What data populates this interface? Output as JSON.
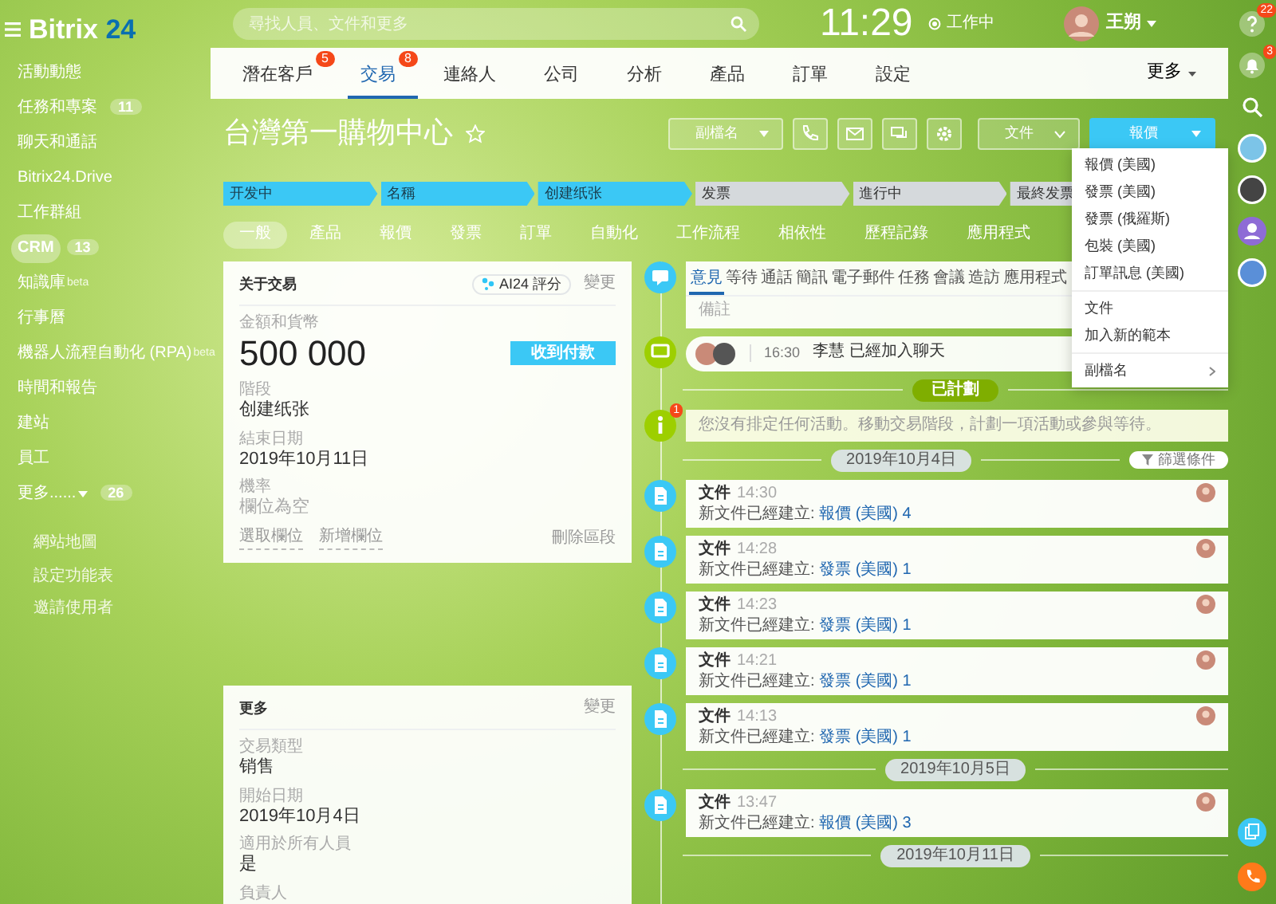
{
  "sidebar": {
    "logo": {
      "text": "Bitrix",
      "number": "24"
    },
    "items": [
      {
        "label": "活動動態",
        "selected": false
      },
      {
        "label": "任務和專案",
        "counter": "11",
        "selected": false
      },
      {
        "label": "聊天和通話",
        "selected": false
      },
      {
        "label": "Bitrix24.Drive",
        "selected": false
      },
      {
        "label": "工作群組",
        "selected": false
      },
      {
        "label": "CRM",
        "counter": "13",
        "selected": true
      },
      {
        "label": "知識庫",
        "beta": "beta",
        "selected": false
      },
      {
        "label": "行事曆",
        "selected": false
      },
      {
        "label": "機器人流程自動化 (RPA)",
        "beta": "beta",
        "selected": false
      },
      {
        "label": "時間和報告",
        "selected": false
      },
      {
        "label": "建站",
        "selected": false
      },
      {
        "label": "員工",
        "selected": false
      },
      {
        "label": "更多......",
        "counter": "26",
        "caret": true,
        "selected": false
      }
    ],
    "footer_links": [
      "網站地圖",
      "設定功能表",
      "邀請使用者"
    ]
  },
  "topbar": {
    "search": {
      "placeholder": "尋找人員、文件和更多"
    },
    "clock": "11:29",
    "work_status": "工作中",
    "user": "王朔"
  },
  "right_bar": {
    "help_counter": "22",
    "notify_counter": "3"
  },
  "crm_tabs": [
    {
      "label": "潛在客戶",
      "counter": "5",
      "selected": false
    },
    {
      "label": "交易",
      "counter": "8",
      "selected": true
    },
    {
      "label": "連絡人",
      "selected": false
    },
    {
      "label": "公司",
      "selected": false
    },
    {
      "label": "分析",
      "selected": false
    },
    {
      "label": "產品",
      "selected": false
    },
    {
      "label": "訂單",
      "selected": false
    },
    {
      "label": "設定",
      "selected": false
    }
  ],
  "crm_more": "更多",
  "deal": {
    "title": "台灣第一購物中心",
    "buttons": {
      "extension": "副檔名",
      "documents": "文件",
      "quote": "報價"
    },
    "stages": [
      {
        "label": "开发中",
        "done": true
      },
      {
        "label": "名稱",
        "done": true
      },
      {
        "label": "创建纸张",
        "done": true
      },
      {
        "label": "发票",
        "done": false
      },
      {
        "label": "進行中",
        "done": false
      },
      {
        "label": "最終发票",
        "done": false
      }
    ],
    "tabs": [
      {
        "label": "一般",
        "selected": true
      },
      {
        "label": "產品",
        "selected": false
      },
      {
        "label": "報價",
        "selected": false
      },
      {
        "label": "發票",
        "selected": false
      },
      {
        "label": "訂單",
        "selected": false
      },
      {
        "label": "自動化",
        "selected": false
      },
      {
        "label": "工作流程",
        "selected": false
      },
      {
        "label": "相依性",
        "selected": false
      },
      {
        "label": "歷程記錄",
        "selected": false
      },
      {
        "label": "應用程式",
        "selected": false
      }
    ]
  },
  "about_card": {
    "title": "关于交易",
    "ai_score": "AI24 評分",
    "change": "變更",
    "amount_label": "金額和貨幣",
    "amount": "500 000",
    "receive_payment": "收到付款",
    "fields": [
      {
        "label": "階段",
        "value": "创建纸张",
        "empty": false
      },
      {
        "label": "結束日期",
        "value": "2019年10月11日",
        "empty": false
      },
      {
        "label": "機率",
        "value": "欄位為空",
        "empty": true
      }
    ],
    "links": [
      "選取欄位",
      "新增欄位"
    ],
    "delete_section": "刪除區段"
  },
  "more_card": {
    "title": "更多",
    "change": "變更",
    "fields": [
      {
        "label": "交易類型",
        "value": "销售"
      },
      {
        "label": "開始日期",
        "value": "2019年10月4日"
      },
      {
        "label": "適用於所有人員",
        "value": "是"
      },
      {
        "label": "負責人"
      }
    ]
  },
  "timeline": {
    "tabs": [
      {
        "label": "意見",
        "selected": true
      },
      {
        "label": "等待",
        "selected": false
      },
      {
        "label": "通話",
        "selected": false
      },
      {
        "label": "簡訊",
        "selected": false
      },
      {
        "label": "電子郵件",
        "selected": false
      },
      {
        "label": "任務",
        "selected": false
      },
      {
        "label": "會議",
        "selected": false
      },
      {
        "label": "造訪",
        "selected": false
      },
      {
        "label": "應用程式",
        "selected": false
      }
    ],
    "comment_placeholder": "備註",
    "chat": {
      "time": "16:30",
      "text": "李慧 已經加入聊天"
    },
    "planned_label": "已計劃",
    "notice": {
      "counter": "1",
      "text": "您沒有排定任何活動。移動交易階段，計劃一項活動或參與等待。"
    },
    "filter": "篩選條件",
    "groups": [
      {
        "date": "2019年10月4日",
        "entries": [
          {
            "title": "文件",
            "time": "14:30",
            "text": "新文件已經建立:",
            "link": "報價 (美國) 4"
          },
          {
            "title": "文件",
            "time": "14:28",
            "text": "新文件已經建立:",
            "link": "發票 (美國) 1"
          },
          {
            "title": "文件",
            "time": "14:23",
            "text": "新文件已經建立:",
            "link": "發票 (美國) 1"
          },
          {
            "title": "文件",
            "time": "14:21",
            "text": "新文件已經建立:",
            "link": "發票 (美國) 1"
          },
          {
            "title": "文件",
            "time": "14:13",
            "text": "新文件已經建立:",
            "link": "發票 (美國) 1"
          }
        ]
      },
      {
        "date": "2019年10月5日",
        "entries": [
          {
            "title": "文件",
            "time": "13:47",
            "text": "新文件已經建立:",
            "link": "報價 (美國) 3"
          }
        ]
      },
      {
        "date": "2019年10月11日"
      }
    ]
  },
  "quote_menu": [
    {
      "label": "報價 (美國)",
      "kind": "item"
    },
    {
      "label": "發票 (美國)",
      "kind": "item"
    },
    {
      "label": "發票 (俄羅斯)",
      "kind": "item"
    },
    {
      "label": "包裝 (美國)",
      "kind": "item"
    },
    {
      "label": "訂單訊息 (美國)",
      "kind": "item"
    },
    {
      "kind": "divider"
    },
    {
      "label": "文件",
      "kind": "item"
    },
    {
      "label": "加入新的範本",
      "kind": "item"
    },
    {
      "kind": "divider"
    },
    {
      "label": "副檔名",
      "kind": "submenu"
    }
  ]
}
